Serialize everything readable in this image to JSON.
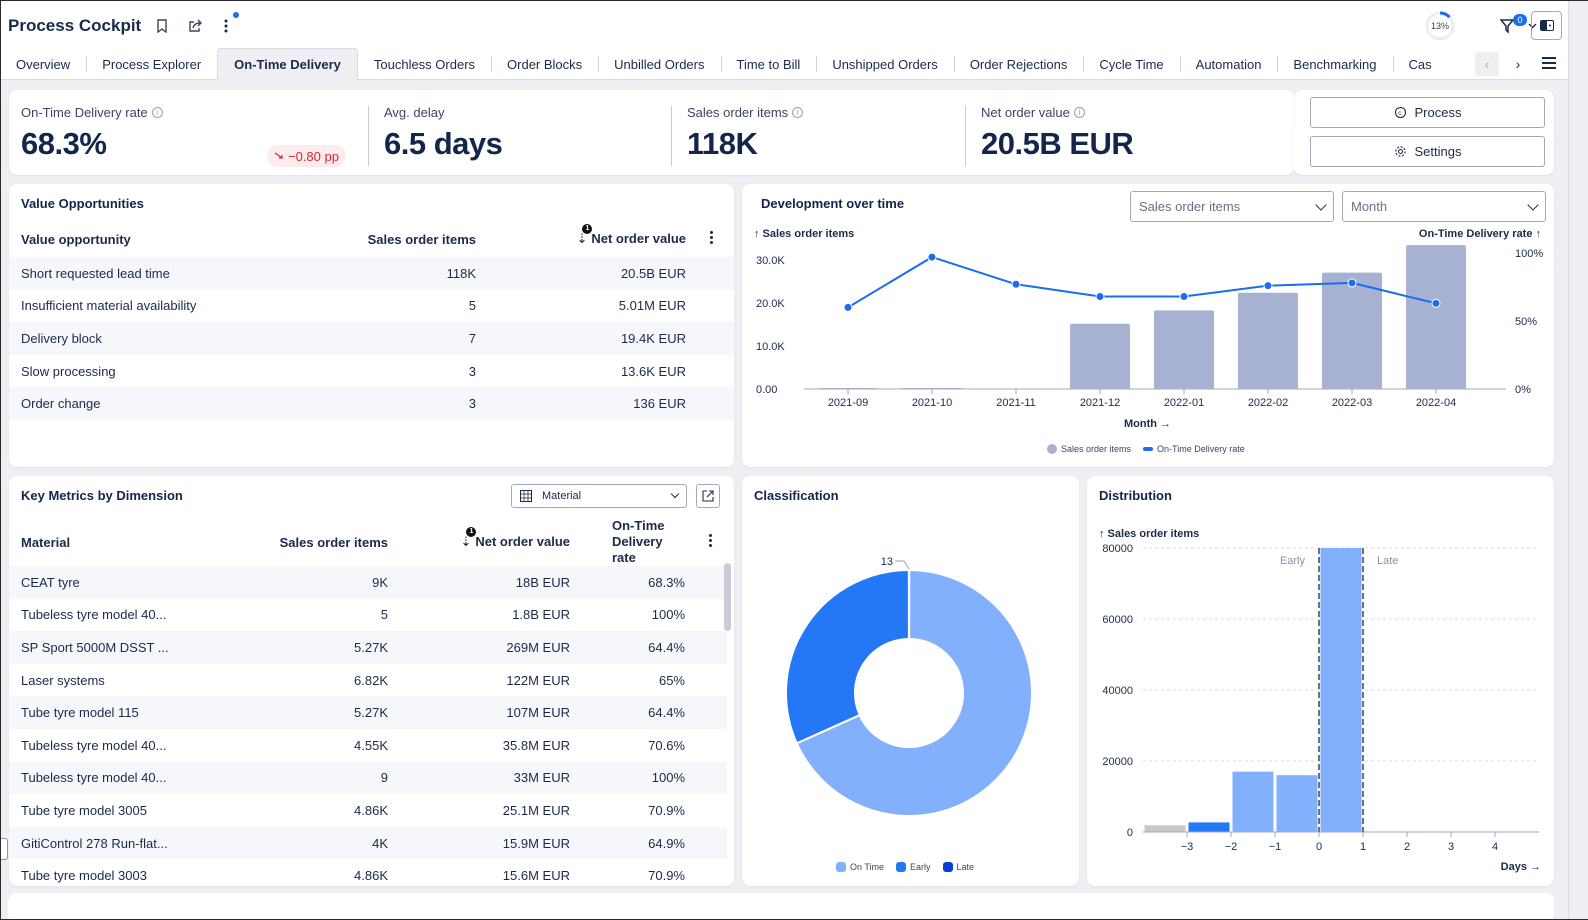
{
  "header": {
    "title": "Process Cockpit",
    "progress_label": "13%",
    "progress_fraction": 0.13,
    "filter_count": "0"
  },
  "tabs": [
    {
      "label": "Overview",
      "active": false
    },
    {
      "label": "Process Explorer",
      "active": false
    },
    {
      "label": "On-Time Delivery",
      "active": true
    },
    {
      "label": "Touchless Orders",
      "active": false
    },
    {
      "label": "Order Blocks",
      "active": false
    },
    {
      "label": "Unbilled Orders",
      "active": false
    },
    {
      "label": "Time to Bill",
      "active": false
    },
    {
      "label": "Unshipped Orders",
      "active": false
    },
    {
      "label": "Order Rejections",
      "active": false
    },
    {
      "label": "Cycle Time",
      "active": false
    },
    {
      "label": "Automation",
      "active": false
    },
    {
      "label": "Benchmarking",
      "active": false
    },
    {
      "label": "Cas",
      "active": false
    }
  ],
  "kpis": [
    {
      "label": "On-Time Delivery rate",
      "value": "68.3%",
      "info": true,
      "delta": "−0.80 pp"
    },
    {
      "label": "Avg. delay",
      "value": "6.5 days",
      "info": false
    },
    {
      "label": "Sales order items",
      "value": "118K",
      "info": true
    },
    {
      "label": "Net order value",
      "value": "20.5B EUR",
      "info": true
    }
  ],
  "actions": {
    "process_label": "Process",
    "settings_label": "Settings"
  },
  "value_opportunities": {
    "title": "Value Opportunities",
    "columns": [
      "Value opportunity",
      "Sales order items",
      "Net order value"
    ],
    "sort_index": "1",
    "rows": [
      [
        "Short requested lead time",
        "118K",
        "20.5B EUR"
      ],
      [
        "Insufficient material availability",
        "5",
        "5.01M EUR"
      ],
      [
        "Delivery block",
        "7",
        "19.4K EUR"
      ],
      [
        "Slow processing",
        "3",
        "13.6K EUR"
      ],
      [
        "Order change",
        "3",
        "136 EUR"
      ]
    ]
  },
  "development": {
    "title": "Development over time",
    "measure_select": "Sales order items",
    "period_select": "Month",
    "y_left_title": "↑ Sales order items",
    "y_right_title": "On-Time Delivery rate ↑",
    "x_title": "Month →",
    "legend": [
      "Sales order items",
      "On-Time Delivery rate"
    ]
  },
  "key_metrics": {
    "title": "Key Metrics by Dimension",
    "dimension_select": "Material",
    "columns": [
      "Material",
      "Sales order items",
      "Net order value",
      "On-Time Delivery rate"
    ],
    "sort_index": "1",
    "rows": [
      [
        "CEAT tyre",
        "9K",
        "18B EUR",
        "68.3%"
      ],
      [
        "Tubeless tyre model 40...",
        "5",
        "1.8B EUR",
        "100%"
      ],
      [
        "SP Sport 5000M DSST ...",
        "5.27K",
        "269M EUR",
        "64.4%"
      ],
      [
        "Laser systems",
        "6.82K",
        "122M EUR",
        "65%"
      ],
      [
        "Tube tyre model 115",
        "5.27K",
        "107M EUR",
        "64.4%"
      ],
      [
        "Tubeless tyre model 40...",
        "4.55K",
        "35.8M EUR",
        "70.6%"
      ],
      [
        "Tubeless tyre model 40...",
        "9",
        "33M EUR",
        "100%"
      ],
      [
        "Tube tyre model 3005",
        "4.86K",
        "25.1M EUR",
        "70.9%"
      ],
      [
        "GitiControl 278 Run-flat...",
        "4K",
        "15.9M EUR",
        "64.9%"
      ],
      [
        "Tube tyre model 3003",
        "4.86K",
        "15.6M EUR",
        "70.9%"
      ]
    ]
  },
  "classification": {
    "title": "Classification",
    "legend": [
      "On Time",
      "Early",
      "Late"
    ]
  },
  "distribution": {
    "title": "Distribution",
    "y_title": "↑ Sales order items",
    "x_title": "Days →",
    "early_label": "Early",
    "late_label": "Late"
  },
  "colors": {
    "accent": "#1a6cf0",
    "bar": "#a7b1d1",
    "on_time": "#82b0fc",
    "early": "#2477f5",
    "late": "#0a3fd6",
    "gray": "#c8c8c8",
    "negative": "#d7263d"
  },
  "chart_data": [
    {
      "type": "bar+line",
      "title": "Development over time",
      "categories": [
        "2021-09",
        "2021-10",
        "2021-11",
        "2021-12",
        "2022-01",
        "2022-02",
        "2022-03",
        "2022-04"
      ],
      "series": [
        {
          "name": "Sales order items",
          "kind": "bar",
          "axis": "left",
          "values": [
            150,
            80,
            0,
            15200,
            18300,
            22400,
            27100,
            33500
          ]
        },
        {
          "name": "On-Time Delivery rate",
          "kind": "line",
          "axis": "right",
          "values": [
            60,
            97,
            77,
            68,
            68,
            76,
            78,
            63
          ]
        }
      ],
      "yleft_ticks": [
        "0.00",
        "10.0K",
        "20.0K",
        "30.0K"
      ],
      "yleft_lim": [
        0,
        34000
      ],
      "yright_ticks": [
        "0%",
        "50%",
        "100%"
      ],
      "yright_lim": [
        0,
        100
      ],
      "xlabel": "Month",
      "ylabel": "Sales order items",
      "y2label": "On-Time Delivery rate",
      "legend_position": "bottom"
    },
    {
      "type": "pie",
      "title": "Classification",
      "donut": true,
      "labels": [
        "On Time",
        "Early",
        "Late"
      ],
      "values": [
        80600,
        37400,
        13
      ],
      "annotations": [
        "13"
      ],
      "legend_position": "bottom"
    },
    {
      "type": "bar",
      "title": "Distribution",
      "x": [
        -3.5,
        -2.5,
        -1.5,
        -0.5,
        0.5
      ],
      "values": [
        1900,
        2700,
        17000,
        16000,
        80000
      ],
      "bar_classes": [
        "gray",
        "early",
        "on_time",
        "on_time",
        "on_time"
      ],
      "x_ticks": [
        -3,
        -2,
        -1,
        0,
        1,
        2,
        3,
        4
      ],
      "y_ticks": [
        0,
        20000,
        40000,
        60000,
        80000
      ],
      "xlim": [
        -4,
        5
      ],
      "ylim": [
        0,
        80000
      ],
      "xlabel": "Days",
      "ylabel": "Sales order items",
      "reference_lines": [
        {
          "x": 0,
          "label": "Early"
        },
        {
          "x": 1,
          "label": "Late"
        }
      ],
      "grid": true
    }
  ]
}
